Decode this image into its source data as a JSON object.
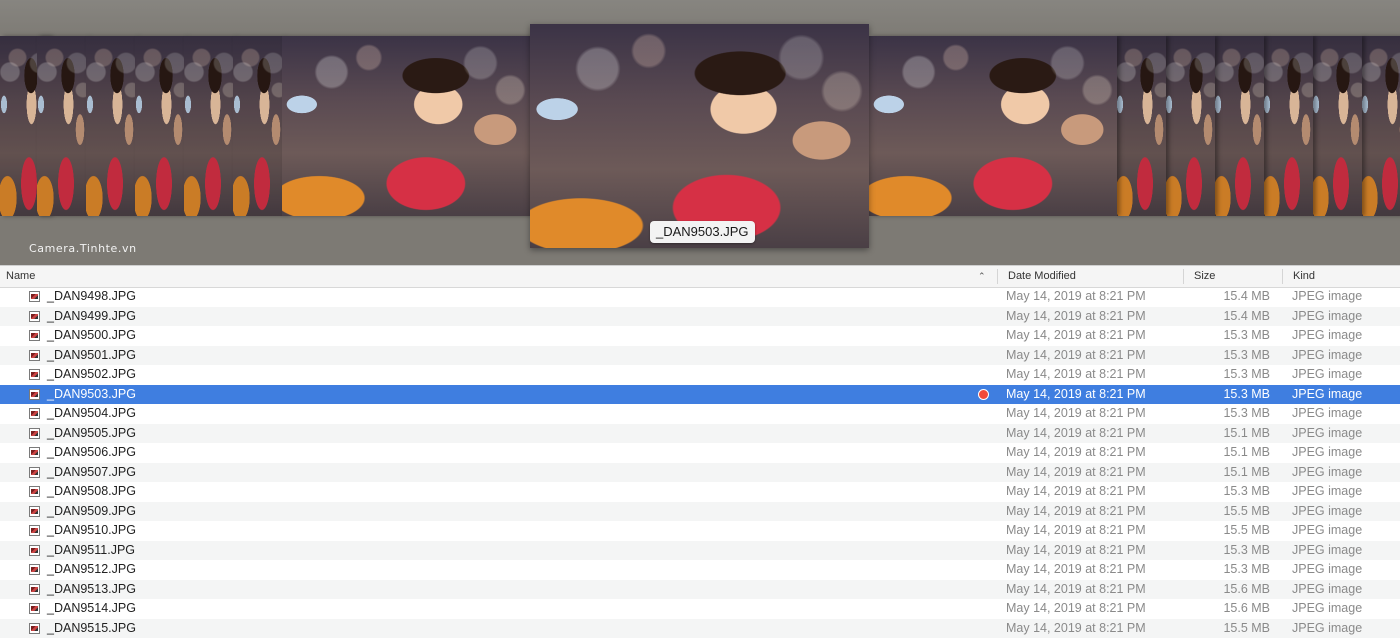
{
  "coverflow": {
    "selected_label": "_DAN9503.JPG",
    "watermark": "Camera.Tinhte.vn"
  },
  "columns": {
    "name": "Name",
    "date": "Date Modified",
    "size": "Size",
    "kind": "Kind",
    "sort_indicator": "chevron-up-icon"
  },
  "colors": {
    "selection": "#3f7ee0",
    "tag": "#f24a3a"
  },
  "files": [
    {
      "name": "_DAN9498.JPG",
      "date": "May 14, 2019 at 8:21 PM",
      "size": "15.4 MB",
      "kind": "JPEG image"
    },
    {
      "name": "_DAN9499.JPG",
      "date": "May 14, 2019 at 8:21 PM",
      "size": "15.4 MB",
      "kind": "JPEG image"
    },
    {
      "name": "_DAN9500.JPG",
      "date": "May 14, 2019 at 8:21 PM",
      "size": "15.3 MB",
      "kind": "JPEG image"
    },
    {
      "name": "_DAN9501.JPG",
      "date": "May 14, 2019 at 8:21 PM",
      "size": "15.3 MB",
      "kind": "JPEG image"
    },
    {
      "name": "_DAN9502.JPG",
      "date": "May 14, 2019 at 8:21 PM",
      "size": "15.3 MB",
      "kind": "JPEG image"
    },
    {
      "name": "_DAN9503.JPG",
      "date": "May 14, 2019 at 8:21 PM",
      "size": "15.3 MB",
      "kind": "JPEG image",
      "selected": true,
      "tag": "red"
    },
    {
      "name": "_DAN9504.JPG",
      "date": "May 14, 2019 at 8:21 PM",
      "size": "15.3 MB",
      "kind": "JPEG image"
    },
    {
      "name": "_DAN9505.JPG",
      "date": "May 14, 2019 at 8:21 PM",
      "size": "15.1 MB",
      "kind": "JPEG image"
    },
    {
      "name": "_DAN9506.JPG",
      "date": "May 14, 2019 at 8:21 PM",
      "size": "15.1 MB",
      "kind": "JPEG image"
    },
    {
      "name": "_DAN9507.JPG",
      "date": "May 14, 2019 at 8:21 PM",
      "size": "15.1 MB",
      "kind": "JPEG image"
    },
    {
      "name": "_DAN9508.JPG",
      "date": "May 14, 2019 at 8:21 PM",
      "size": "15.3 MB",
      "kind": "JPEG image"
    },
    {
      "name": "_DAN9509.JPG",
      "date": "May 14, 2019 at 8:21 PM",
      "size": "15.5 MB",
      "kind": "JPEG image"
    },
    {
      "name": "_DAN9510.JPG",
      "date": "May 14, 2019 at 8:21 PM",
      "size": "15.5 MB",
      "kind": "JPEG image"
    },
    {
      "name": "_DAN9511.JPG",
      "date": "May 14, 2019 at 8:21 PM",
      "size": "15.3 MB",
      "kind": "JPEG image"
    },
    {
      "name": "_DAN9512.JPG",
      "date": "May 14, 2019 at 8:21 PM",
      "size": "15.3 MB",
      "kind": "JPEG image"
    },
    {
      "name": "_DAN9513.JPG",
      "date": "May 14, 2019 at 8:21 PM",
      "size": "15.6 MB",
      "kind": "JPEG image"
    },
    {
      "name": "_DAN9514.JPG",
      "date": "May 14, 2019 at 8:21 PM",
      "size": "15.6 MB",
      "kind": "JPEG image"
    },
    {
      "name": "_DAN9515.JPG",
      "date": "May 14, 2019 at 8:21 PM",
      "size": "15.5 MB",
      "kind": "JPEG image"
    }
  ]
}
